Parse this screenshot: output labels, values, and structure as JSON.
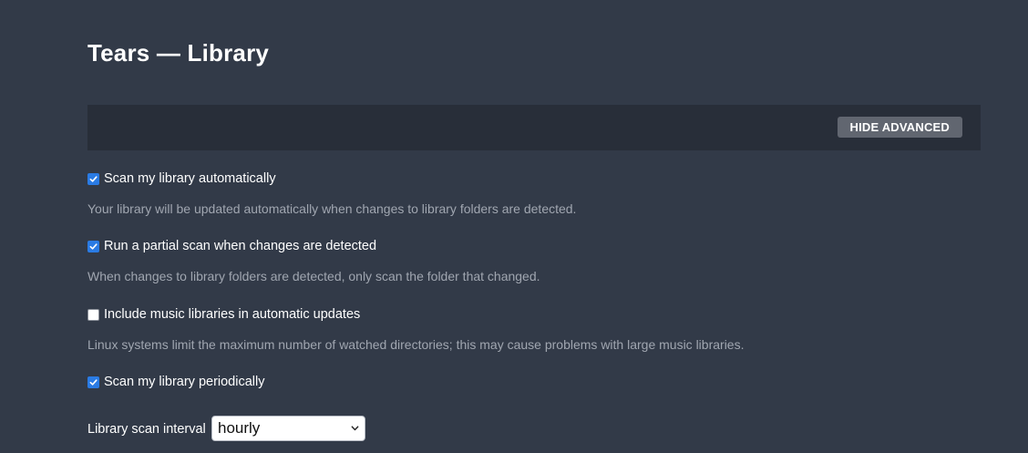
{
  "header": {
    "title": "Tears — Library"
  },
  "toolbar": {
    "hide_advanced_label": "HIDE ADVANCED"
  },
  "settings": [
    {
      "label": "Scan my library automatically",
      "checked": true,
      "help": "Your library will be updated automatically when changes to library folders are detected."
    },
    {
      "label": "Run a partial scan when changes are detected",
      "checked": true,
      "help": "When changes to library folders are detected, only scan the folder that changed."
    },
    {
      "label": "Include music libraries in automatic updates",
      "checked": false,
      "help": "Linux systems limit the maximum number of watched directories; this may cause problems with large music libraries."
    },
    {
      "label": "Scan my library periodically",
      "checked": true
    }
  ],
  "scan_interval": {
    "label": "Library scan interval",
    "value": "hourly"
  },
  "colors": {
    "background": "#323a48",
    "toolbar": "#282e39",
    "accent": "#2a7be4",
    "help_text": "#a0a6b0"
  }
}
